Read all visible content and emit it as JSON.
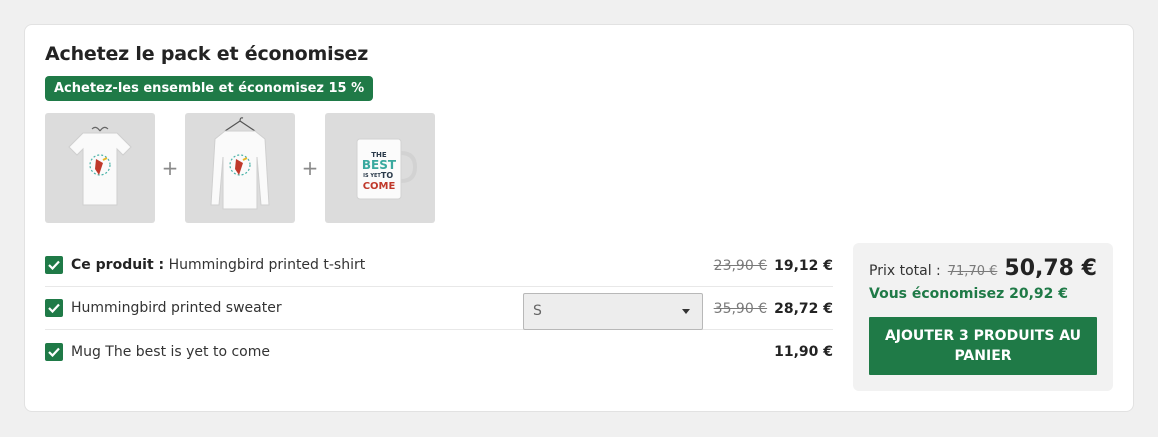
{
  "bundle": {
    "title": "Achetez le pack et économisez",
    "badge": "Achetez-les ensemble et économisez 15 %",
    "plus": "+",
    "images": [
      {
        "alt": "Hummingbird printed t-shirt"
      },
      {
        "alt": "Hummingbird printed sweater"
      },
      {
        "alt": "Mug The best is yet to come",
        "print_lines": [
          "THE",
          "BEST",
          "IS YET",
          "TO",
          "COME"
        ]
      }
    ],
    "items": [
      {
        "prefix": "Ce produit :",
        "name": "Hummingbird printed t-shirt",
        "old_price": "23,90 €",
        "price": "19,12 €",
        "checked": true
      },
      {
        "prefix": "",
        "name": "Hummingbird printed sweater",
        "old_price": "35,90 €",
        "price": "28,72 €",
        "checked": true,
        "select_value": "S"
      },
      {
        "prefix": "",
        "name": "Mug The best is yet to come",
        "old_price": "",
        "price": "11,90 €",
        "checked": true
      }
    ],
    "summary": {
      "total_label": "Prix total :",
      "total_old": "71,70 €",
      "total_new": "50,78 €",
      "savings": "Vous économisez 20,92 €",
      "cta_label": "AJOUTER 3 PRODUITS AU PANIER"
    }
  },
  "colors": {
    "accent": "#1f7a47",
    "card_bg": "#ffffff",
    "page_bg": "#f0f0f0",
    "summary_bg": "#f2f2f2"
  }
}
